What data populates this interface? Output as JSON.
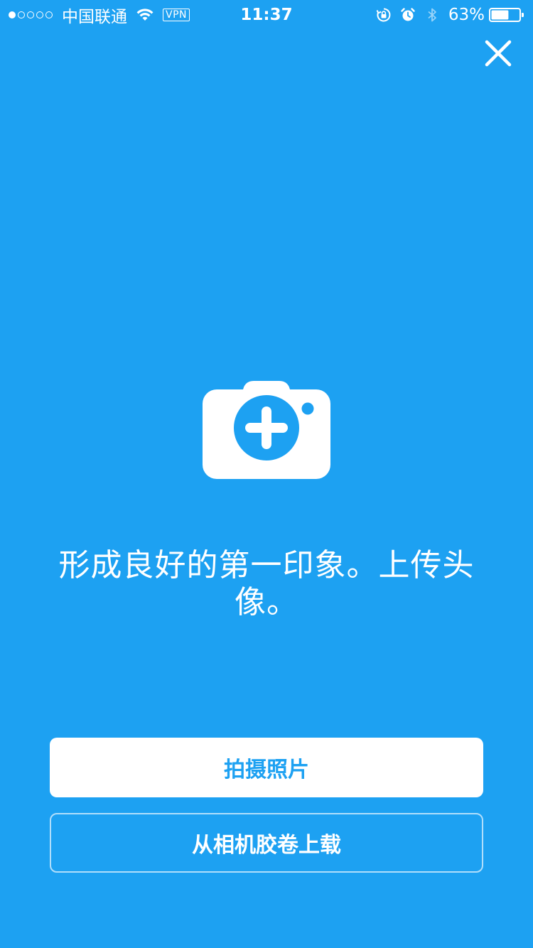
{
  "status_bar": {
    "carrier": "中国联通",
    "vpn": "VPN",
    "time": "11:37",
    "battery": "63%",
    "battery_level": 0.63,
    "signal_bars_filled": 1,
    "signal_bars_total": 5
  },
  "icons": {
    "close": "close-icon",
    "camera": "camera-plus-icon",
    "wifi": "wifi-icon",
    "lock": "rotation-lock-icon",
    "alarm": "alarm-icon",
    "bluetooth": "bluetooth-icon",
    "battery": "battery-icon"
  },
  "colors": {
    "background": "#1DA1F2",
    "primary_button_bg": "#FFFFFF",
    "primary_button_text": "#1DA1F2",
    "text": "#FFFFFF"
  },
  "main": {
    "headline": "形成良好的第一印象。上传头像。"
  },
  "actions": {
    "take_photo": "拍摄照片",
    "upload_from_camera_roll": "从相机胶卷上载"
  }
}
